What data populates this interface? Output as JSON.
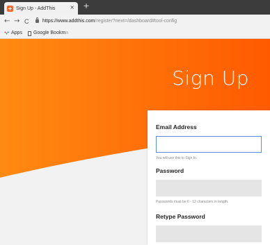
{
  "browser": {
    "tab": {
      "title": "Sign Up - AddThis",
      "close_glyph": "×",
      "favicon_glyph": "+"
    },
    "new_tab_glyph": "+",
    "nav": {
      "back": "←",
      "forward": "→",
      "reload": "C"
    },
    "url": {
      "host": "https://www.addthis.com",
      "path": "/register?next=/dashboard#tool-config"
    },
    "bookmarks": [
      {
        "label": "Apps"
      },
      {
        "label": "Google Bookm",
        "faded_suffix": "a"
      }
    ]
  },
  "page": {
    "title": "Sign Up",
    "brand_colors": {
      "orange_light": "#ff8a12",
      "orange_dark": "#ff5a00",
      "panel": "#f2f2f2"
    },
    "form": {
      "email": {
        "label": "Email Address",
        "hint": "You will use this to Sign In.",
        "value": ""
      },
      "password": {
        "label": "Password",
        "hint": "Passwords must be 6 - 12 characters in length.",
        "value": ""
      },
      "retype_password": {
        "label": "Retype Password",
        "value": ""
      }
    }
  }
}
